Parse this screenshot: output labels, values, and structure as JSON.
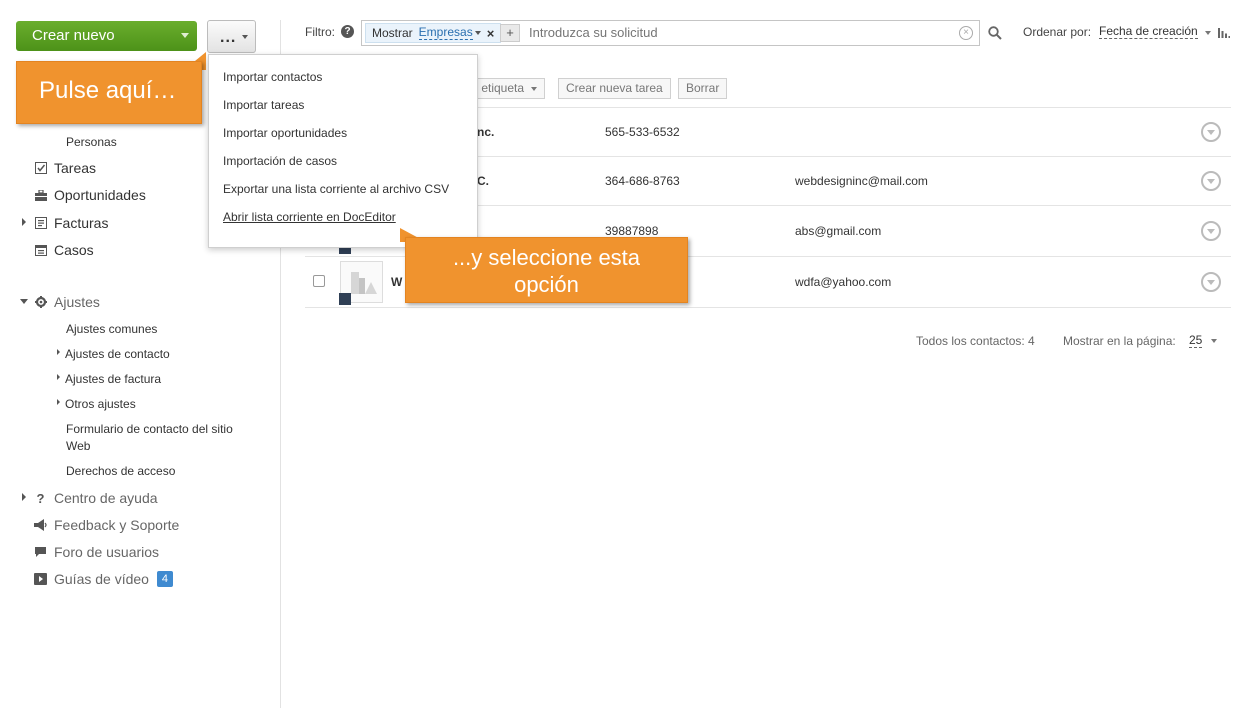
{
  "header": {
    "create_button": "Crear nuevo",
    "more_button": "...",
    "filter": {
      "label": "Filtro:",
      "help": "?",
      "chip_prefix": "Mostrar",
      "chip_value": "Empresas",
      "chip_remove": "×",
      "add": "+",
      "placeholder": "Introduzca su solicitud",
      "clear": "×"
    },
    "sort": {
      "label": "Ordenar por:",
      "value": "Fecha de creación"
    }
  },
  "dropdown_menu": {
    "items": [
      "Importar contactos",
      "Importar tareas",
      "Importar oportunidades",
      "Importación de casos",
      "Exportar una lista corriente al archivo CSV",
      "Abrir lista corriente en DocEditor"
    ]
  },
  "callouts": {
    "first": "Pulse aquí…",
    "second_line1": "...y seleccione esta",
    "second_line2": "opción"
  },
  "sidebar": {
    "personas": "Personas",
    "tareas": "Tareas",
    "oportunidades": "Oportunidades",
    "facturas": "Facturas",
    "casos": "Casos",
    "ajustes": "Ajustes",
    "ajustes_items": [
      "Ajustes comunes",
      "Ajustes de contacto",
      "Ajustes de factura",
      "Otros ajustes",
      "Formulario de contacto del sitio",
      "Web",
      "Derechos de acceso"
    ],
    "centro_ayuda": "Centro de ayuda",
    "feedback": "Feedback y Soporte",
    "foro": "Foro de usuarios",
    "guias": "Guías de vídeo",
    "guias_badge": "4"
  },
  "actions": {
    "tag": "r etiqueta",
    "new_task": "Crear nueva tarea",
    "delete": "Borrar"
  },
  "table": {
    "rows": [
      {
        "name": "nc.",
        "phone": "565-533-6532",
        "email": ""
      },
      {
        "name": "C.",
        "phone": "364-686-8763",
        "email": "webdesigninc@mail.com"
      },
      {
        "name": "",
        "phone": "39887898",
        "email": "abs@gmail.com"
      },
      {
        "name": "W",
        "phone": "",
        "email": "wdfa@yahoo.com"
      }
    ]
  },
  "footer": {
    "total": "Todos los contactos: 4",
    "per_page_label": "Mostrar en la página:",
    "per_page_value": "25"
  },
  "colors": {
    "create_green": "#5ba023",
    "callout_orange": "#f0932e",
    "link_blue": "#2a6faf",
    "badge_blue": "#3f8ad0"
  }
}
